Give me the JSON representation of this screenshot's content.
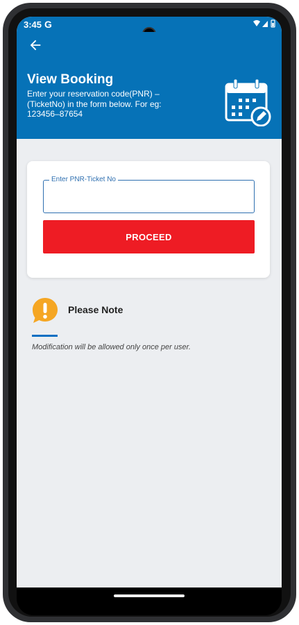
{
  "status_bar": {
    "time": "3:45",
    "google_indicator": "G"
  },
  "header": {
    "title": "View Booking",
    "subtitle": "Enter your reservation code(PNR) –(TicketNo) in the form below. For eg: 123456–87654",
    "background_color": "#0672b7",
    "back_icon": "arrow-left-icon",
    "calendar_icon": "calendar-edit-icon"
  },
  "form": {
    "pnr_label": "Enter PNR-Ticket No",
    "pnr_value": "",
    "proceed_label": "PROCEED",
    "proceed_color": "#ee1c24"
  },
  "note": {
    "icon": "exclamation-speech-bubble-icon",
    "title": "Please Note",
    "text": "Modification will be allowed only once per user.",
    "accent_color": "#f5a623"
  }
}
